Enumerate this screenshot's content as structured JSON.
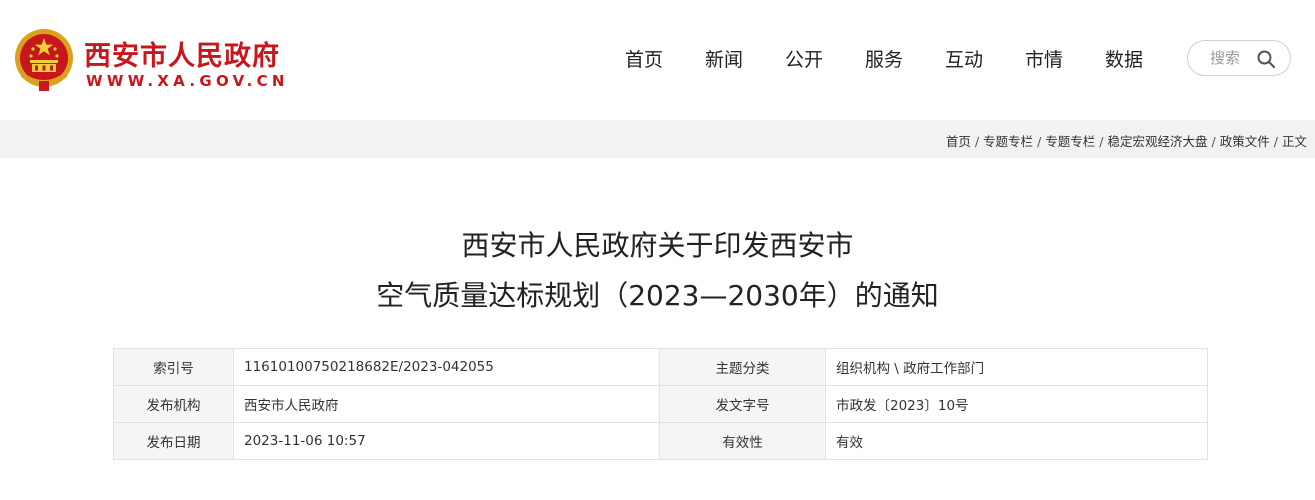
{
  "header": {
    "site_name": "西安市人民政府",
    "site_domain": "WWW.XA.GOV.CN",
    "logo_icon": "national-emblem-icon",
    "brand_color": "#c8161d"
  },
  "nav": {
    "items": [
      "首页",
      "新闻",
      "公开",
      "服务",
      "互动",
      "市情",
      "数据"
    ]
  },
  "search": {
    "placeholder": "搜索",
    "icon": "search-icon"
  },
  "breadcrumb": {
    "items": [
      "首页",
      "专题专栏",
      "专题专栏",
      "稳定宏观经济大盘",
      "政策文件",
      "正文"
    ],
    "separator": "/"
  },
  "article": {
    "title_line1": "西安市人民政府关于印发西安市",
    "title_line2": "空气质量达标规划（2023—2030年）的通知"
  },
  "meta": {
    "rows": [
      {
        "k1": "索引号",
        "v1": "11610100750218682E/2023-042055",
        "k2": "主题分类",
        "v2": "组织机构 \\ 政府工作部门"
      },
      {
        "k1": "发布机构",
        "v1": "西安市人民政府",
        "k2": "发文字号",
        "v2": "市政发〔2023〕10号"
      },
      {
        "k1": "发布日期",
        "v1": "2023-11-06 10:57",
        "k2": "有效性",
        "v2": "有效"
      }
    ]
  }
}
